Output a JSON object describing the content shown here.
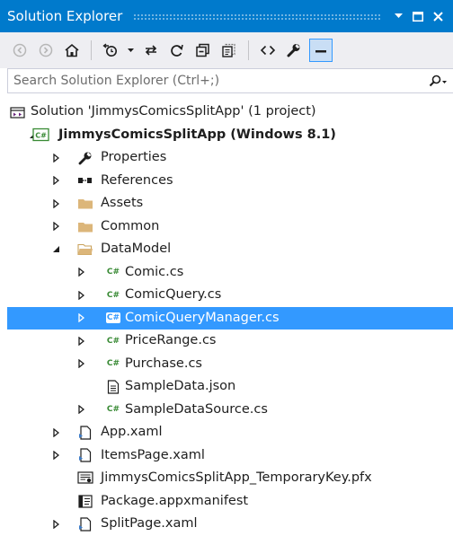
{
  "window": {
    "title": "Solution Explorer",
    "buttons": [
      "dropdown",
      "maximize",
      "close"
    ]
  },
  "toolbar": {
    "buttons": [
      "back-icon",
      "forward-icon",
      "home-icon",
      "pending-changes-icon",
      "dropdown",
      "sync-icon",
      "refresh-icon",
      "collapse-all-icon",
      "show-all-files-icon",
      "view-code-icon",
      "properties-icon",
      "preview-icon"
    ]
  },
  "search": {
    "placeholder": "Search Solution Explorer (Ctrl+;)"
  },
  "tree": [
    {
      "label": "Solution 'JimmysComicsSplitApp' (1 project)",
      "depth": 0,
      "arrow": "none",
      "icon": "solution-icon"
    },
    {
      "label": "JimmysComicsSplitApp (Windows 8.1)",
      "depth": 0,
      "arrow": "expanded",
      "icon": "csharp-project-icon",
      "bold": true
    },
    {
      "label": "Properties",
      "depth": 1,
      "arrow": "collapsed",
      "icon": "wrench-icon"
    },
    {
      "label": "References",
      "depth": 1,
      "arrow": "collapsed",
      "icon": "references-icon"
    },
    {
      "label": "Assets",
      "depth": 1,
      "arrow": "collapsed",
      "icon": "folder-icon"
    },
    {
      "label": "Common",
      "depth": 1,
      "arrow": "collapsed",
      "icon": "folder-icon"
    },
    {
      "label": "DataModel",
      "depth": 1,
      "arrow": "expanded",
      "icon": "folder-open-icon"
    },
    {
      "label": "Comic.cs",
      "depth": 2,
      "arrow": "collapsed",
      "icon": "csharp-file-icon"
    },
    {
      "label": "ComicQuery.cs",
      "depth": 2,
      "arrow": "collapsed",
      "icon": "csharp-file-icon"
    },
    {
      "label": "ComicQueryManager.cs",
      "depth": 2,
      "arrow": "collapsed",
      "icon": "csharp-file-icon",
      "selected": true
    },
    {
      "label": "PriceRange.cs",
      "depth": 2,
      "arrow": "collapsed",
      "icon": "csharp-file-icon"
    },
    {
      "label": "Purchase.cs",
      "depth": 2,
      "arrow": "collapsed",
      "icon": "csharp-file-icon"
    },
    {
      "label": "SampleData.json",
      "depth": 2,
      "arrow": "none",
      "icon": "json-file-icon"
    },
    {
      "label": "SampleDataSource.cs",
      "depth": 2,
      "arrow": "collapsed",
      "icon": "csharp-file-icon"
    },
    {
      "label": "App.xaml",
      "depth": 1,
      "arrow": "collapsed",
      "icon": "xaml-file-icon"
    },
    {
      "label": "ItemsPage.xaml",
      "depth": 1,
      "arrow": "collapsed",
      "icon": "xaml-file-icon"
    },
    {
      "label": "JimmysComicsSplitApp_TemporaryKey.pfx",
      "depth": 1,
      "arrow": "none",
      "icon": "certificate-icon"
    },
    {
      "label": "Package.appxmanifest",
      "depth": 1,
      "arrow": "none",
      "icon": "manifest-icon"
    },
    {
      "label": "SplitPage.xaml",
      "depth": 1,
      "arrow": "collapsed",
      "icon": "xaml-file-icon"
    }
  ],
  "colors": {
    "title_bar": "#007acc",
    "toolbar": "#eeeef2",
    "selection": "#3399ff",
    "csharp_green": "#388a34",
    "folder": "#dcb67a"
  }
}
